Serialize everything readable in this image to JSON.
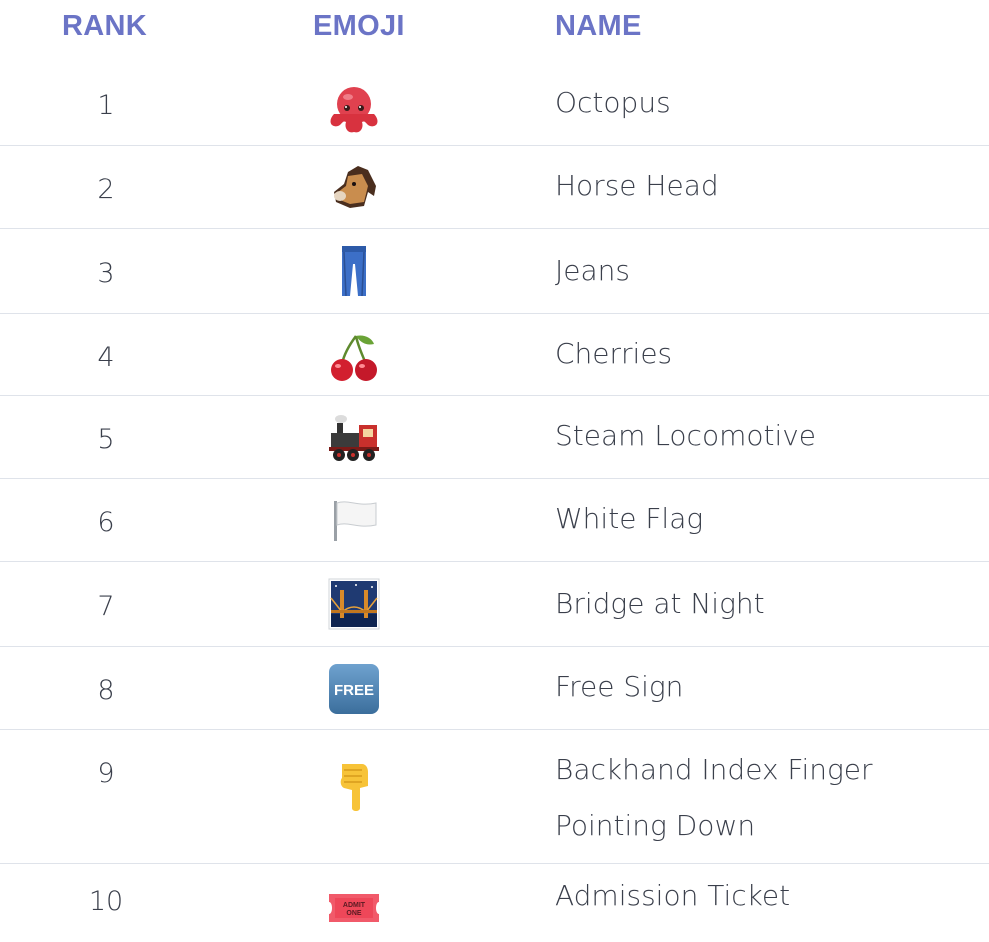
{
  "header": {
    "rank": "RANK",
    "emoji": "EMOJI",
    "name": "NAME"
  },
  "colors": {
    "header": "#6b74c6",
    "text": "#3a3f4b",
    "divider": "#dfe3ea"
  },
  "rows": [
    {
      "rank": "1",
      "name": "Octopus",
      "icon": "octopus-icon"
    },
    {
      "rank": "2",
      "name": "Horse Head",
      "icon": "horse-head-icon"
    },
    {
      "rank": "3",
      "name": "Jeans",
      "icon": "jeans-icon"
    },
    {
      "rank": "4",
      "name": "Cherries",
      "icon": "cherries-icon"
    },
    {
      "rank": "5",
      "name": "Steam Locomotive",
      "icon": "steam-locomotive-icon"
    },
    {
      "rank": "6",
      "name": "White Flag",
      "icon": "white-flag-icon"
    },
    {
      "rank": "7",
      "name": "Bridge at Night",
      "icon": "bridge-at-night-icon"
    },
    {
      "rank": "8",
      "name": "Free Sign",
      "icon": "free-sign-icon",
      "icon_text": "FREE"
    },
    {
      "rank": "9",
      "name": "Backhand Index Finger Pointing Down",
      "icon": "backhand-index-pointing-down-icon"
    },
    {
      "rank": "10",
      "name": "Admission Ticket",
      "icon": "admission-ticket-icon",
      "icon_text": "ADMIT ONE"
    }
  ]
}
